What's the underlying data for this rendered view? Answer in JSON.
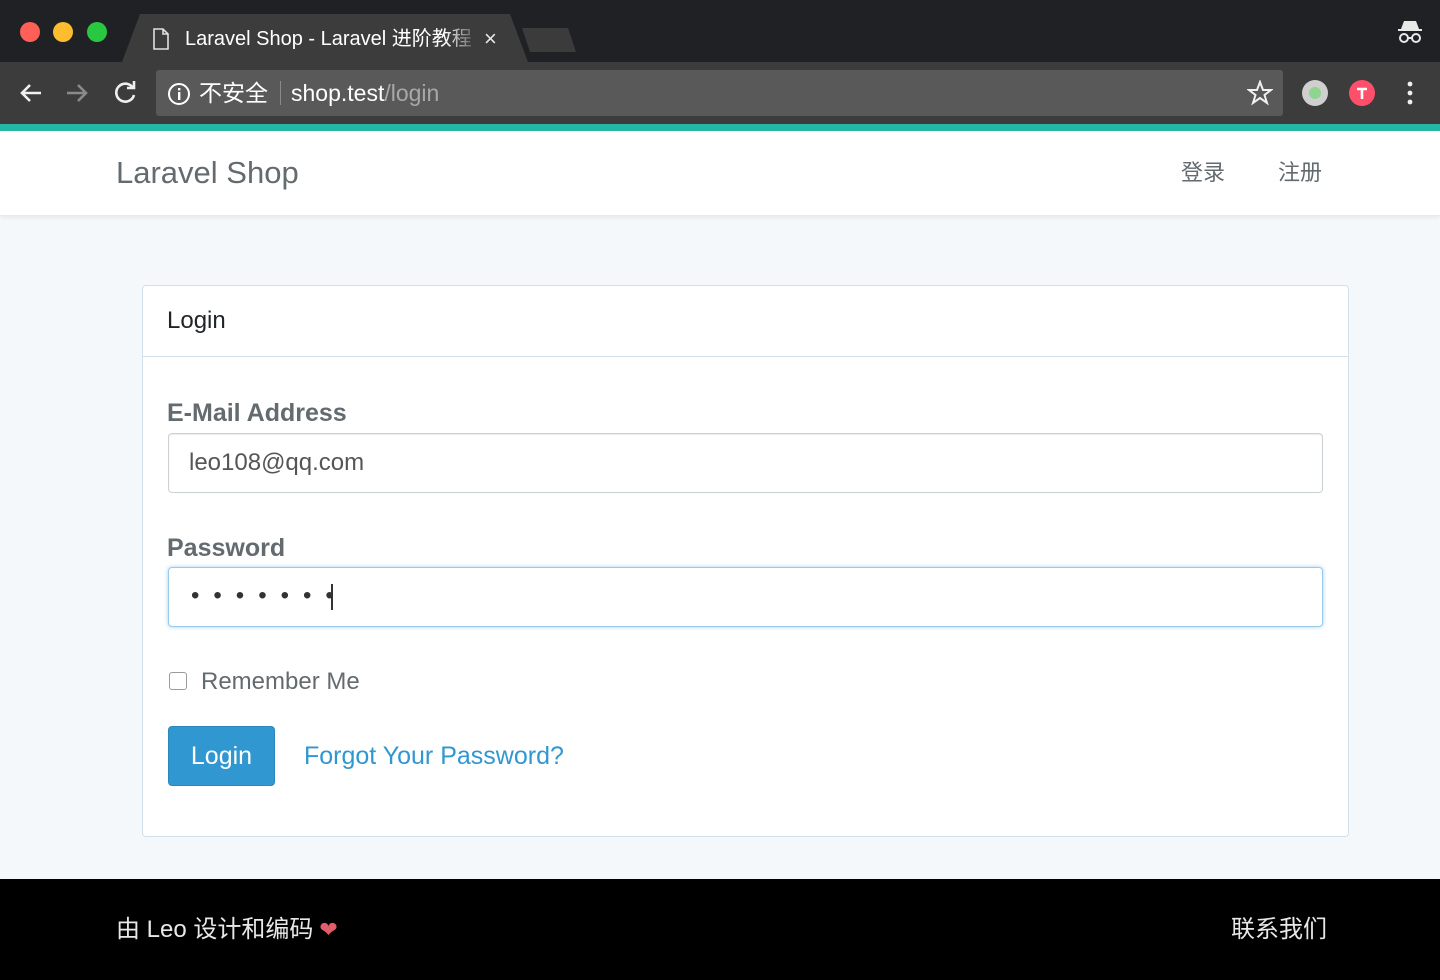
{
  "browser": {
    "tab_title": "Laravel Shop - Laravel 进阶教程",
    "tab_close": "×",
    "security_label": "不安全",
    "url_host": "shop.test",
    "url_path": "/login",
    "icons": [
      "document-icon",
      "close-icon",
      "incognito-icon",
      "back-icon",
      "forward-icon",
      "reload-icon",
      "info-icon",
      "star-icon",
      "extension-icon",
      "menu-icon"
    ]
  },
  "navbar": {
    "brand": "Laravel Shop",
    "login_link": "登录",
    "register_link": "注册"
  },
  "login_card": {
    "title": "Login",
    "email_label": "E-Mail Address",
    "email_value": "leo108@qq.com",
    "password_label": "Password",
    "password_masked": "•••••••",
    "remember_label": "Remember Me",
    "remember_checked": false,
    "login_button": "Login",
    "forgot_link": "Forgot Your Password?"
  },
  "footer": {
    "credit": "由 Leo 设计和编码",
    "heart": "❤",
    "contact": "联系我们"
  },
  "colors": {
    "accent_line": "#24b7a4",
    "primary": "#3097d1",
    "background": "#f5f8fa",
    "footer_bg": "#000000"
  }
}
